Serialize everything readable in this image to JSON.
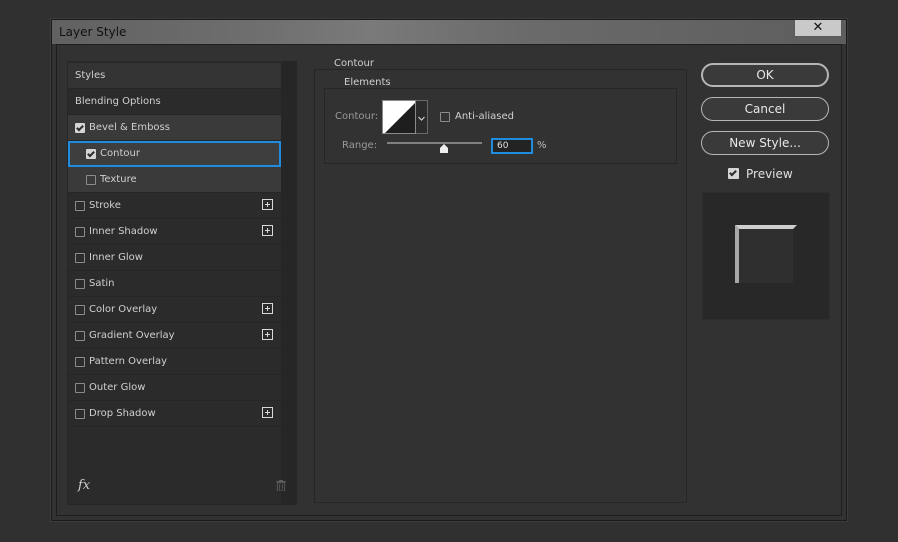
{
  "window": {
    "title": "Layer Style",
    "close_glyph": "✕"
  },
  "styles_list": {
    "items": [
      {
        "label": "Styles",
        "checkbox": false,
        "checked": false,
        "indent": false,
        "plus": false,
        "state": "header"
      },
      {
        "label": "Blending Options",
        "checkbox": false,
        "checked": false,
        "indent": false,
        "plus": false,
        "state": "normal"
      },
      {
        "label": "Bevel & Emboss",
        "checkbox": true,
        "checked": true,
        "indent": false,
        "plus": false,
        "state": "active"
      },
      {
        "label": "Contour",
        "checkbox": true,
        "checked": true,
        "indent": true,
        "plus": false,
        "state": "selected"
      },
      {
        "label": "Texture",
        "checkbox": true,
        "checked": false,
        "indent": true,
        "plus": false,
        "state": "active"
      },
      {
        "label": "Stroke",
        "checkbox": true,
        "checked": false,
        "indent": false,
        "plus": true,
        "state": "normal"
      },
      {
        "label": "Inner Shadow",
        "checkbox": true,
        "checked": false,
        "indent": false,
        "plus": true,
        "state": "normal"
      },
      {
        "label": "Inner Glow",
        "checkbox": true,
        "checked": false,
        "indent": false,
        "plus": false,
        "state": "normal"
      },
      {
        "label": "Satin",
        "checkbox": true,
        "checked": false,
        "indent": false,
        "plus": false,
        "state": "normal"
      },
      {
        "label": "Color Overlay",
        "checkbox": true,
        "checked": false,
        "indent": false,
        "plus": true,
        "state": "normal"
      },
      {
        "label": "Gradient Overlay",
        "checkbox": true,
        "checked": false,
        "indent": false,
        "plus": true,
        "state": "normal"
      },
      {
        "label": "Pattern Overlay",
        "checkbox": true,
        "checked": false,
        "indent": false,
        "plus": false,
        "state": "normal"
      },
      {
        "label": "Outer Glow",
        "checkbox": true,
        "checked": false,
        "indent": false,
        "plus": false,
        "state": "normal"
      },
      {
        "label": "Drop Shadow",
        "checkbox": true,
        "checked": false,
        "indent": false,
        "plus": true,
        "state": "normal"
      }
    ],
    "footer": {
      "fx_label": "fx"
    }
  },
  "contour_panel": {
    "group_title": "Contour",
    "subgroup_title": "Elements",
    "contour_label": "Contour:",
    "anti_aliased_label": "Anti-aliased",
    "anti_aliased_checked": false,
    "range_label": "Range:",
    "range_value": "60",
    "range_fraction": 0.6,
    "range_unit": "%"
  },
  "buttons": {
    "ok": "OK",
    "cancel": "Cancel",
    "new_style": "New Style..."
  },
  "preview": {
    "label": "Preview",
    "checked": true
  },
  "colors": {
    "accent": "#1f8cdf",
    "background": "#323232"
  }
}
